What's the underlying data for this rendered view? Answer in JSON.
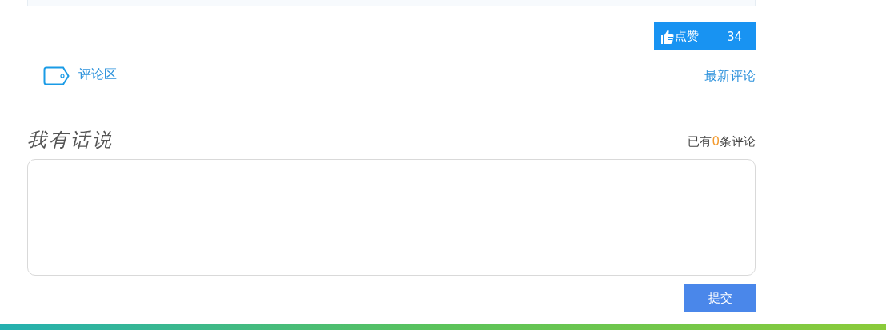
{
  "like_button": {
    "label": "点赞",
    "count": "34"
  },
  "section_header": {
    "title": "评论区",
    "sort_link": "最新评论"
  },
  "comment_form": {
    "heading": "我有话说",
    "count_prefix": "已有",
    "count": "0",
    "count_suffix": "条评论",
    "submit": "提交"
  }
}
